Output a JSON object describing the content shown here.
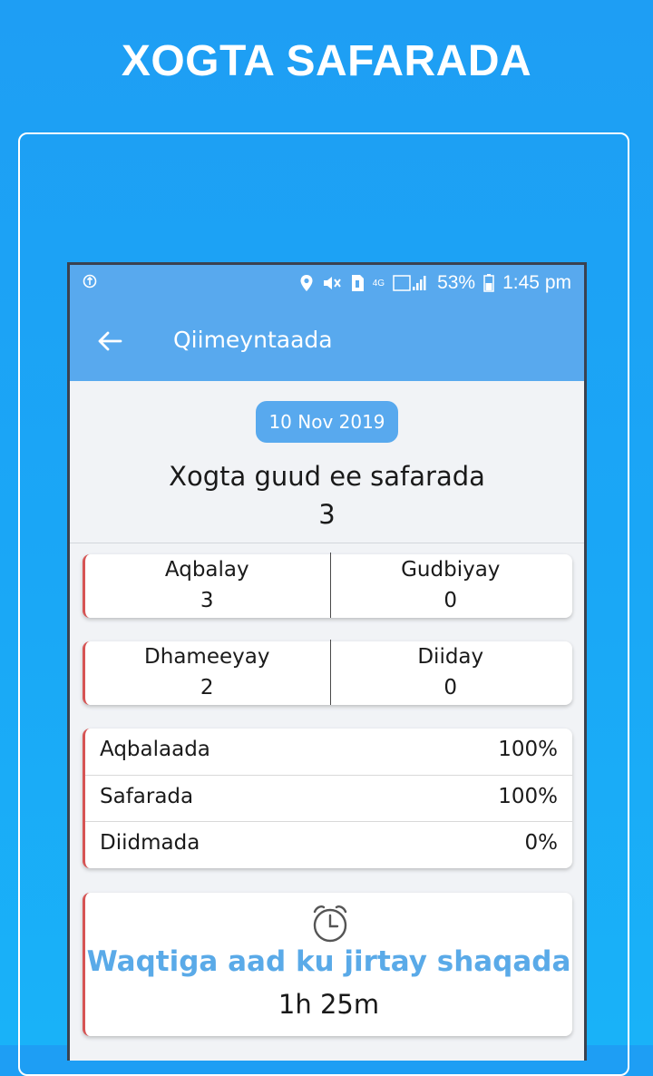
{
  "promo": {
    "title": "XOGTA SAFARADA"
  },
  "status_bar": {
    "battery": "53%",
    "time": "1:45 pm",
    "network": "4G"
  },
  "header": {
    "title": "Qiimeyntaada",
    "back_icon": "arrow-left-icon"
  },
  "summary": {
    "date": "10 Nov 2019",
    "title": "Xogta guud ee safarada",
    "count": "3"
  },
  "stats": [
    [
      {
        "label": "Aqbalay",
        "value": "3"
      },
      {
        "label": "Gudbiyay",
        "value": "0"
      }
    ],
    [
      {
        "label": "Dhameeyay",
        "value": "2"
      },
      {
        "label": "Diiday",
        "value": "0"
      }
    ]
  ],
  "rates": [
    {
      "label": "Aqbalaada",
      "value": "100%"
    },
    {
      "label": "Safarada",
      "value": "100%"
    },
    {
      "label": "Diidmada",
      "value": "0%"
    }
  ],
  "time": {
    "label": "Waqtiga aad ku jirtay shaqada",
    "value": "1h 25m",
    "icon": "alarm-clock-icon"
  },
  "colors": {
    "accent": "#58a9ee",
    "card_edge": "#d65454",
    "background": "#1ea3f5"
  }
}
